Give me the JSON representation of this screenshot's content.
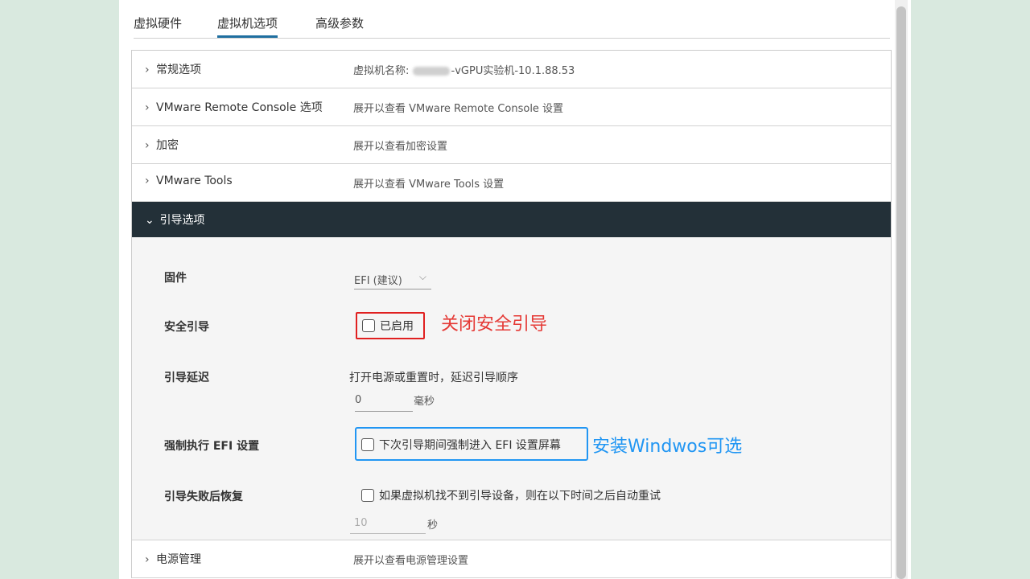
{
  "tabs": [
    "虚拟硬件",
    "虚拟机选项",
    "高级参数"
  ],
  "rows_top": [
    {
      "label": "常规选项",
      "value_prefix": "虚拟机名称:",
      "value": "-vGPU实验机-10.1.88.53"
    },
    {
      "label": "VMware Remote Console 选项",
      "value_prefix": "",
      "value": "展开以查看 VMware Remote Console 设置"
    },
    {
      "label": "加密",
      "value_prefix": "",
      "value": "展开以查看加密设置"
    },
    {
      "label": "VMware Tools",
      "value_prefix": "",
      "value": "展开以查看 VMware Tools 设置"
    }
  ],
  "boot": {
    "title": "引导选项",
    "firmware": {
      "label": "固件",
      "value": "EFI (建议)"
    },
    "secure_boot": {
      "label": "安全引导",
      "checkbox": "已启用",
      "annotation": "关闭安全引导"
    },
    "boot_delay": {
      "label": "引导延迟",
      "desc": "打开电源或重置时，延迟引导顺序",
      "value": "0",
      "unit": "毫秒"
    },
    "force_efi": {
      "label": "强制执行 EFI 设置",
      "checkbox": "下次引导期间强制进入 EFI 设置屏幕",
      "annotation": "安装Windwos可选"
    },
    "failed_boot": {
      "label": "引导失败后恢复",
      "checkbox": "如果虚拟机找不到引导设备，则在以下时间之后自动重试",
      "value": "10",
      "unit": "秒"
    }
  },
  "rows_bottom": [
    {
      "label": "电源管理",
      "value": "展开以查看电源管理设置"
    }
  ],
  "icons": {
    "collapsed": "chevron-right",
    "expanded": "chevron-down",
    "select": "chevron-down"
  },
  "colors": {
    "annotation_red": "#e53935",
    "annotation_blue": "#2196f3",
    "header_dark": "#233038",
    "tab_active": "#1f6fa0"
  }
}
